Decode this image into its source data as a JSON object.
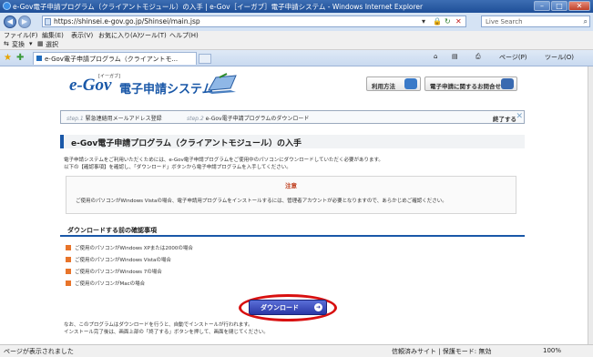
{
  "window": {
    "title": "e-Gov電子申請プログラム（クライアントモジュール）の入手 | e-Gov［イーガブ］電子申請システム - Windows Internet Explorer"
  },
  "address": {
    "url": "https://shinsei.e-gov.go.jp/Shinsei/main.jsp"
  },
  "search": {
    "placeholder": "Live Search"
  },
  "menu": [
    "ファイル(F)",
    "編集(E)",
    "表示(V)",
    "お気に入り(A)",
    "ツール(T)",
    "ヘルプ(H)"
  ],
  "links": {
    "convert": "変換",
    "select": "選択"
  },
  "tab": {
    "label": "e-Gov電子申請プログラム（クライアントモ..."
  },
  "toolbar": {
    "page": "ページ(P)",
    "tools": "ツール(O)"
  },
  "header": {
    "logo": "e-Gov",
    "logo_kana": "[イーガブ]",
    "system": "電子申請システム",
    "usage": "利用方法",
    "inquiry": "電子申請に関するお問合せ"
  },
  "steps": {
    "step1_num": "step.1",
    "step1": "緊急連絡用メールアドレス登録",
    "step2_num": "step.2",
    "step2": "e-Gov電子申請プログラムのダウンロード",
    "done": "終了する"
  },
  "main": {
    "heading": "e-Gov電子申請プログラム（クライアントモジュール）の入手",
    "intro1": "電子申請システムをご利用いただくためには、e-Gov電子申請プログラムをご使用中のパソコンにダウンロードしていただく必要があります。",
    "intro2": "以下の【確認事項】を確認し、「ダウンロード」ボタンから電子申請プログラムを入手してください。",
    "note_title": "注意",
    "note_body": "ご使用のパソコンがWindows Vistaの場合、電子申請用プログラムをインストールするには、管理者アカウントが必要となりますので、あらかじめご確認ください。",
    "section": "ダウンロードする前の確認事項",
    "items": [
      "ご使用のパソコンがWindows XPまたは2000の場合",
      "ご使用のパソコンがWindows Vistaの場合",
      "ご使用のパソコンがWindows 7の場合",
      "ご使用のパソコンがMacの場合"
    ],
    "download": "ダウンロード",
    "foot1": "なお、このプログラムはダウンロードを行うと、自動でインストールが行われます。",
    "foot2": "インストール完了後は、画面上部の「終了する」ボタンを押して、画面を閉じてください。"
  },
  "status": {
    "text": "ページが表示されました",
    "zone": "信頼済みサイト | 保護モード: 無効",
    "zoom": "100%"
  }
}
